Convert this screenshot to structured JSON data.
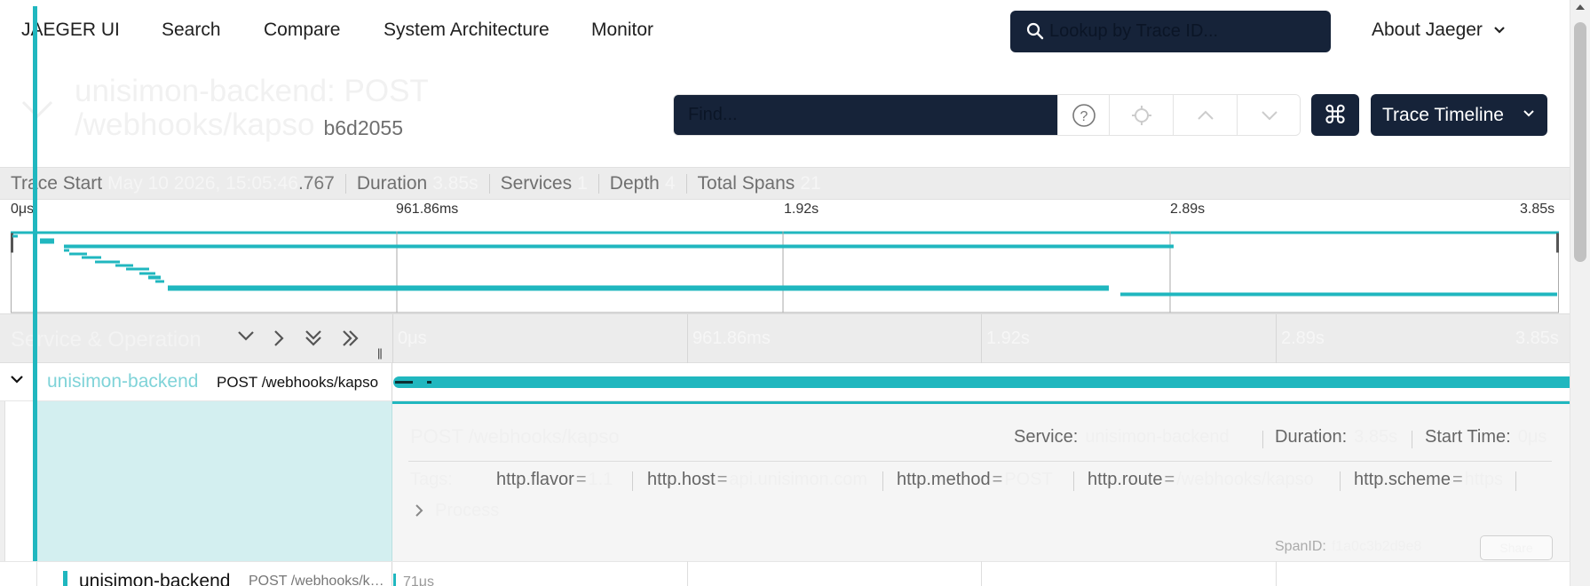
{
  "nav": {
    "brand": "JAEGER UI",
    "items": [
      "Search",
      "Compare",
      "System Architecture",
      "Monitor"
    ],
    "lookup_placeholder": "Lookup by Trace ID...",
    "about": "About Jaeger"
  },
  "trace": {
    "title": "unisimon-backend: POST /webhooks/kapso",
    "trace_id_short": "b6d2055",
    "find_placeholder": "Find...",
    "view_label": "Trace Timeline",
    "shortcut_icon": "⌘"
  },
  "summary": {
    "trace_start_label": "Trace Start",
    "trace_start_value": "May 10 2026, 15:05:46",
    "trace_start_ms": ".767",
    "duration_label": "Duration",
    "duration_value": "3.85s",
    "services_label": "Services",
    "services_value": "1",
    "depth_label": "Depth",
    "depth_value": "4",
    "total_spans_label": "Total Spans",
    "total_spans_value": "21"
  },
  "minimap": {
    "ticks": [
      "0μs",
      "961.86ms",
      "1.92s",
      "2.89s",
      "3.85s"
    ]
  },
  "timeline": {
    "header_title": "Service & Operation",
    "ticks": [
      "0μs",
      "961.86ms",
      "1.92s",
      "2.89s",
      "3.85s"
    ]
  },
  "span_root": {
    "service": "unisimon-backend",
    "operation": "POST /webhooks/kapso"
  },
  "detail": {
    "title": "POST /webhooks/kapso",
    "service_label": "Service:",
    "service_value": "unisimon-backend",
    "duration_label": "Duration:",
    "duration_value": "3.85s",
    "start_label": "Start Time:",
    "start_value": "0μs",
    "tags_label": "Tags:",
    "tags": [
      {
        "key": "http.flavor",
        "value": "1.1"
      },
      {
        "key": "http.host",
        "value": "api.unisimon.com"
      },
      {
        "key": "http.method",
        "value": "POST"
      },
      {
        "key": "http.route",
        "value": "/webhooks/kapso"
      },
      {
        "key": "http.scheme",
        "value": "https"
      }
    ],
    "process_label": "Process",
    "spanid_label": "SpanID:",
    "spanid_value": "f1a0c3b2d9e8",
    "share_label": "Share"
  },
  "span_child": {
    "service": "unisimon-backend",
    "operation": "POST /webhooks/kapso",
    "duration_label": "71μs"
  },
  "colors": {
    "accent": "#20b7bf",
    "navy": "#162339",
    "detail_bg": "#d3eff0"
  }
}
